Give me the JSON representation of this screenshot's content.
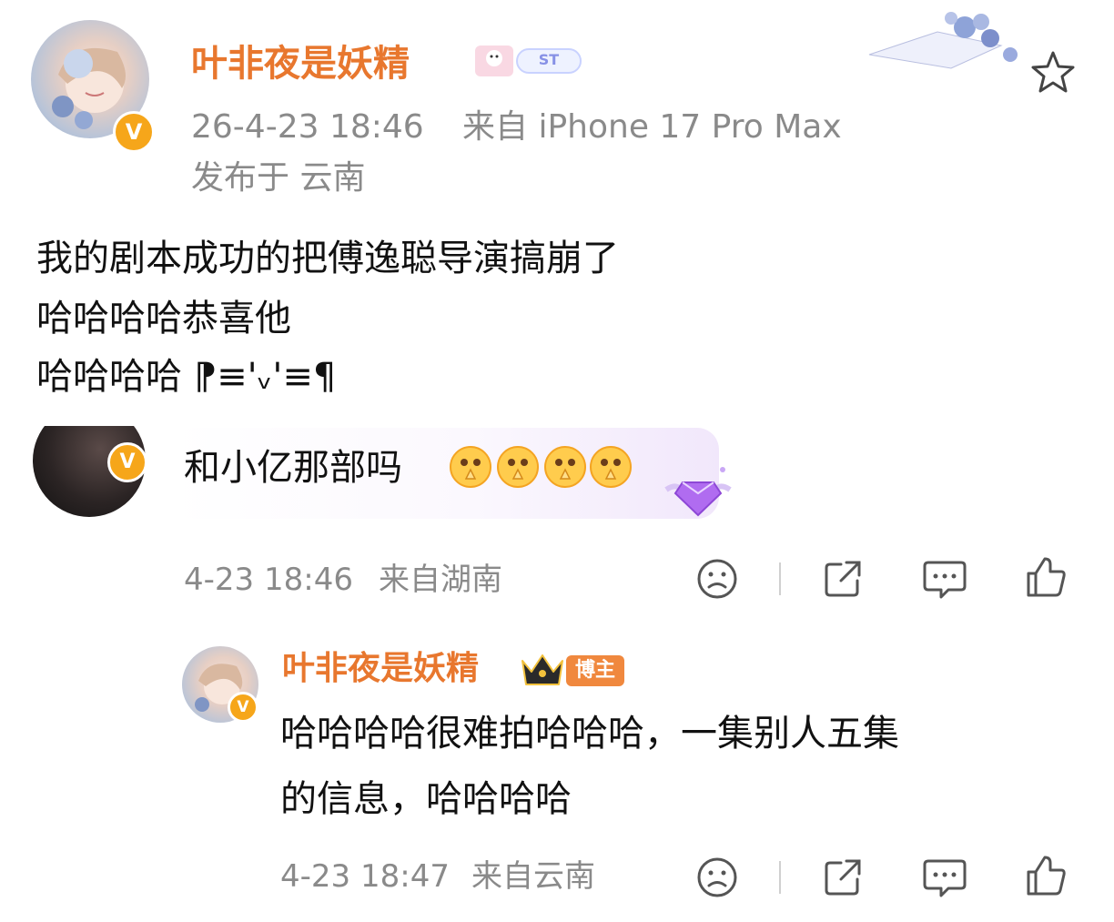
{
  "post": {
    "author": "叶非夜是妖精",
    "time": "26-4-23 18:46",
    "source": "来自 iPhone 17 Pro Max",
    "location": "发布于 云南",
    "body_lines": [
      "我的剧本成功的把傅逸聪导演搞崩了",
      "哈哈哈哈恭喜他",
      "哈哈哈哈 ⁋≡'ᵥ'≡¶"
    ],
    "verified_badge": "V",
    "decor_label": "ST"
  },
  "comment": {
    "text": "和小亿那部吗",
    "emoji_count_shown": 4,
    "time": "4-23 18:46",
    "location": "来自湖南",
    "verified_badge": "V"
  },
  "reply": {
    "author": "叶非夜是妖精",
    "role_badge": "博主",
    "text_lines": [
      "哈哈哈哈很难拍哈哈哈，一集别人五集",
      "的信息，哈哈哈哈"
    ],
    "time": "4-23 18:47",
    "location": "来自云南",
    "verified_badge": "V"
  },
  "colors": {
    "name": "#e8772e",
    "meta": "#8a8a8a",
    "badge": "#f6a61a",
    "comment_bubble": "#f5eefc",
    "icon_stroke": "#555555",
    "role_badge": "#f0883e"
  },
  "icons": {
    "star": "star-icon",
    "dislike": "sad-face-icon",
    "share": "share-icon",
    "comment": "comment-icon",
    "like": "thumbs-up-icon"
  }
}
